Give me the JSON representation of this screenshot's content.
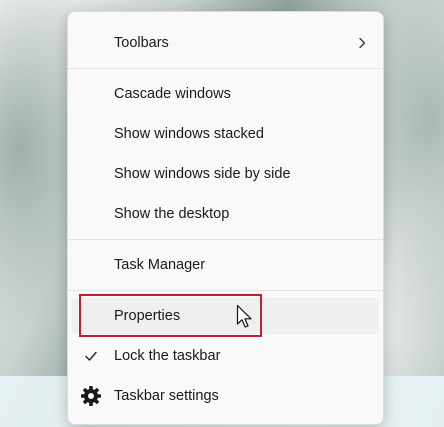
{
  "context_menu": {
    "toolbars_label": "Toolbars",
    "cascade_label": "Cascade windows",
    "stacked_label": "Show windows stacked",
    "side_by_side_label": "Show windows side by side",
    "desktop_label": "Show the desktop",
    "task_manager_label": "Task Manager",
    "properties_label": "Properties",
    "lock_taskbar_label": "Lock the taskbar",
    "taskbar_settings_label": "Taskbar settings"
  },
  "icons": {
    "submenu": "chevron-right-icon",
    "checked": "checkmark-icon",
    "settings": "gear-icon",
    "pointer": "mouse-cursor-icon"
  },
  "state": {
    "hovered_item": "Properties",
    "lock_taskbar_checked": true
  },
  "colors": {
    "annotation_box": "#c0212e",
    "menu_background": "#f9f9f9",
    "hover_background": "#efefef"
  }
}
